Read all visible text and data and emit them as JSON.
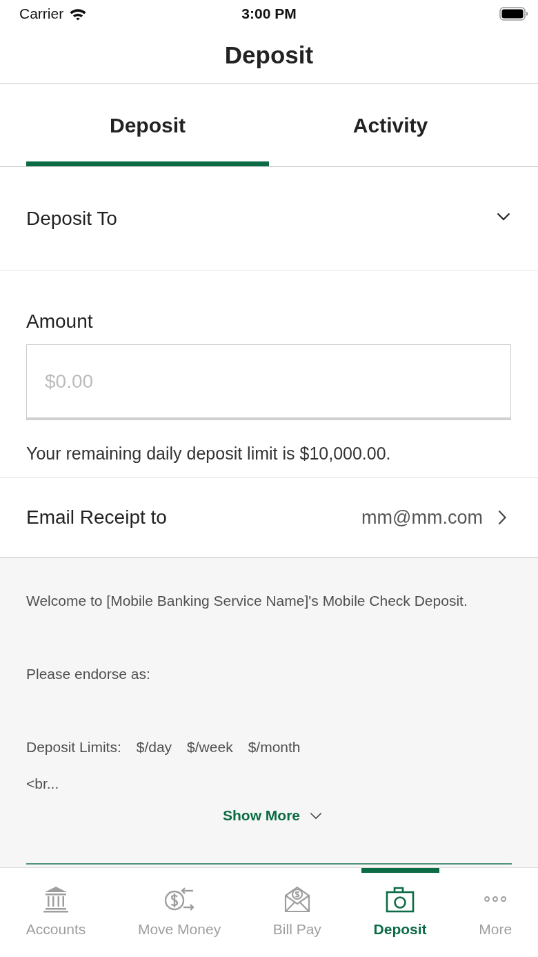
{
  "status_bar": {
    "carrier": "Carrier",
    "time": "3:00 PM"
  },
  "nav": {
    "title": "Deposit"
  },
  "tabs": [
    {
      "label": "Deposit",
      "selected": true
    },
    {
      "label": "Activity",
      "selected": false
    }
  ],
  "form": {
    "deposit_to": {
      "label": "Deposit To"
    },
    "amount": {
      "label": "Amount",
      "placeholder": "$0.00"
    },
    "limit_note": "Your remaining daily deposit limit is $10,000.00.",
    "email_receipt": {
      "label": "Email Receipt to",
      "value": "mm@mm.com"
    }
  },
  "info": {
    "paragraphs": [
      "Welcome to [Mobile Banking Service Name]'s Mobile Check Deposit.",
      "Please endorse as:"
    ],
    "limits_label": "Deposit Limits:",
    "limits": [
      "$/day",
      "$/week",
      "$/month"
    ],
    "truncated": "<br...",
    "show_more": "Show More"
  },
  "tab_bar": [
    {
      "label": "Accounts",
      "selected": false
    },
    {
      "label": "Move Money",
      "selected": false
    },
    {
      "label": "Bill Pay",
      "selected": false
    },
    {
      "label": "Deposit",
      "selected": true
    },
    {
      "label": "More",
      "selected": false
    }
  ]
}
